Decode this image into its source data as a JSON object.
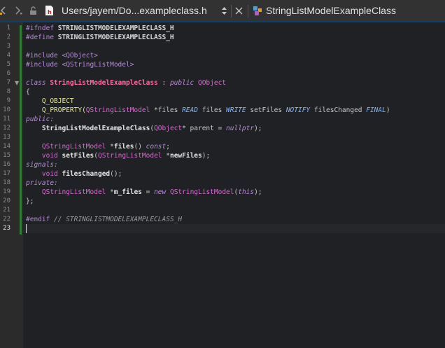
{
  "toolbar": {
    "path": "Users/jayem/Do...exampleclass.h",
    "symbol": "StringListModelExampleClass"
  },
  "icons": {
    "back": "chevron-left-icon",
    "forward": "chevron-right-icon",
    "lock": "lock-icon",
    "file": "header-file-icon",
    "updown": "updown-arrows-icon",
    "close": "close-icon",
    "symbol": "class-symbol-icon"
  },
  "lines": [
    {
      "n": "1"
    },
    {
      "n": "2"
    },
    {
      "n": "3"
    },
    {
      "n": "4"
    },
    {
      "n": "5"
    },
    {
      "n": "6"
    },
    {
      "n": "7"
    },
    {
      "n": "8"
    },
    {
      "n": "9"
    },
    {
      "n": "10"
    },
    {
      "n": "11"
    },
    {
      "n": "12"
    },
    {
      "n": "13"
    },
    {
      "n": "14"
    },
    {
      "n": "15"
    },
    {
      "n": "16"
    },
    {
      "n": "17"
    },
    {
      "n": "18"
    },
    {
      "n": "19"
    },
    {
      "n": "20"
    },
    {
      "n": "21"
    },
    {
      "n": "22"
    },
    {
      "n": "23"
    }
  ],
  "code": {
    "l1a": "#ifndef ",
    "l1b": "STRINGLISTMODELEXAMPLECLASS_H",
    "l2a": "#define ",
    "l2b": "STRINGLISTMODELEXAMPLECLASS_H",
    "l4a": "#include ",
    "l4b": "<QObject>",
    "l5a": "#include ",
    "l5b": "<QStringListModel>",
    "l7a": "class ",
    "l7b": "StringListModelExampleClass",
    " l7c": " : ",
    "l7d": "public ",
    "l7e": "QObject",
    "l8": "{",
    "l9": "    Q_OBJECT",
    "l10a": "    Q_PROPERTY(",
    "l10b": "QStringListModel",
    " l10c": " *files ",
    "l10d": "READ",
    " l10e": " files ",
    "l10f": "WRITE",
    " l10g": " setFiles ",
    "l10h": "NOTIFY",
    " l10i": " filesChanged ",
    "l10j": "FINAL",
    ")l10k": ")",
    "l11": "public:",
    "l12a": "    ",
    "l12b": "StringListModelExampleClass",
    "l12c": "(",
    "l12d": "QObject",
    "l12e": "* parent = ",
    "l12f": "nullptr",
    "l12g": ");",
    "l14a": "    ",
    "l14b": "QStringListModel",
    " l14c": " *",
    "l14d": "files",
    "l14e": "() ",
    "l14f": "const",
    ";l14g": ";",
    "l15a": "    ",
    "l15b": "void",
    " l15c": " ",
    "l15d": "setFiles",
    "l15e": "(",
    "l15f": "QStringListModel",
    " l15g": " *",
    "l15h": "newFiles",
    "l15i": ");",
    "l16": "signals:",
    "l17a": "    ",
    "l17b": "void",
    " l17c": " ",
    "l17d": "filesChanged",
    "l17e": "();",
    "l18": "private:",
    "l19a": "    ",
    "l19b": "QStringListModel",
    " l19c": " *",
    "l19d": "m_files",
    " l19e": " = ",
    "l19f": "new",
    " l19g": " ",
    "l19h": "QStringListModel",
    "l19i": "(",
    "l19j": "this",
    "l19k": ");",
    "l20": "};",
    "l22a": "#endif",
    " l22b": " // STRINGLISTMODELEXAMPLECLASS_H"
  },
  "colors": {
    "accent": "#0f3f6b",
    "gutter": "#2b2b2b",
    "editor": "#202124",
    "modbar": "#2f7d32"
  }
}
